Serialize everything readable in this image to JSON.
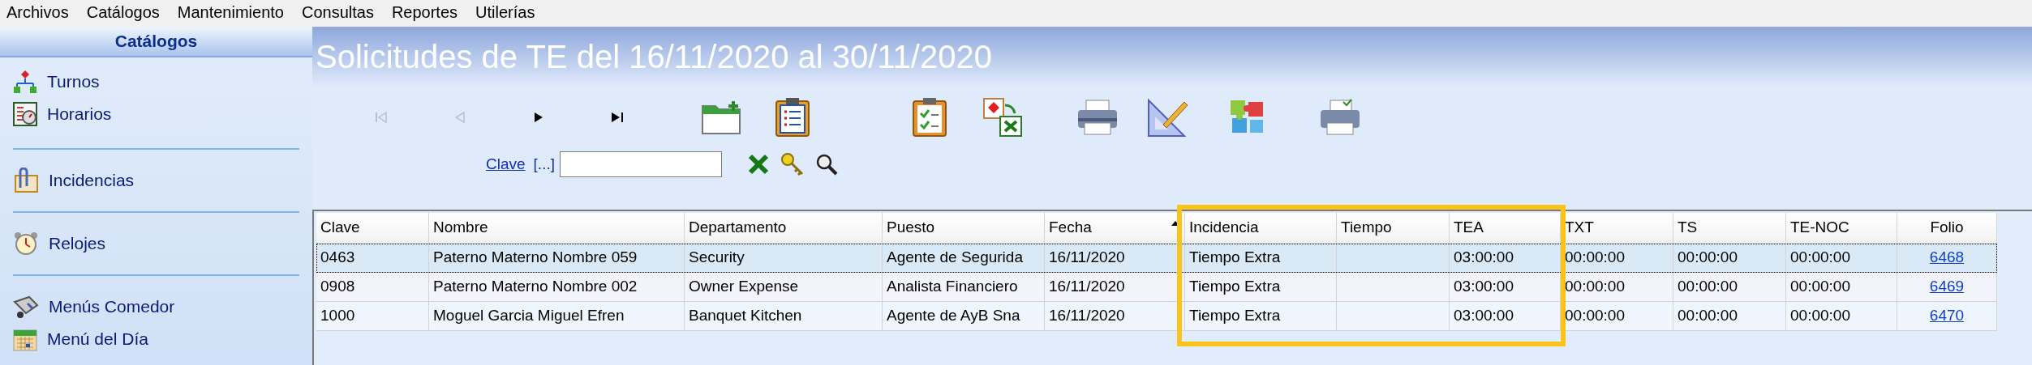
{
  "menu_bar": [
    "Archivos",
    "Catálogos",
    "Mantenimiento",
    "Consultas",
    "Reportes",
    "Utilerías"
  ],
  "sidebar": {
    "title": "Catálogos",
    "groups": [
      {
        "items": [
          {
            "label": "Turnos",
            "kind": "tree"
          },
          {
            "label": "Horarios",
            "kind": "schedule"
          }
        ]
      },
      {
        "items": [
          {
            "label": "Incidencias",
            "kind": "clip"
          }
        ]
      },
      {
        "items": [
          {
            "label": "Relojes",
            "kind": "alarm"
          }
        ]
      },
      {
        "items": [
          {
            "label": "Menús Comedor",
            "kind": "dining"
          },
          {
            "label": "Menú del Día",
            "kind": "calendar"
          }
        ]
      }
    ]
  },
  "title": "Solicitudes de TE del 16/11/2020 al 30/11/2020",
  "nav_buttons": [
    {
      "kind": "first",
      "disabled": true
    },
    {
      "kind": "prev",
      "disabled": true
    },
    {
      "kind": "next",
      "disabled": false
    },
    {
      "kind": "last",
      "disabled": false
    }
  ],
  "filter": {
    "label": "Clave",
    "browse": "[...]"
  },
  "table": {
    "columns": [
      {
        "label": "Clave",
        "sorted": false
      },
      {
        "label": "Nombre",
        "sorted": false
      },
      {
        "label": "Departamento",
        "sorted": false
      },
      {
        "label": "Puesto",
        "sorted": false
      },
      {
        "label": "Fecha",
        "sorted": true
      },
      {
        "label": "Incidencia",
        "sorted": false
      },
      {
        "label": "Tiempo",
        "sorted": false
      },
      {
        "label": "TEA",
        "sorted": false
      },
      {
        "label": "TXT",
        "sorted": false
      },
      {
        "label": "TS",
        "sorted": false
      },
      {
        "label": "TE-NOC",
        "sorted": false
      },
      {
        "label": "Folio",
        "sorted": false
      }
    ],
    "highlight_frame": true,
    "rows": [
      {
        "selected": true,
        "cells": [
          "0463",
          "Paterno  Materno  Nombre 059",
          "Security",
          "Agente de Segurida",
          "16/11/2020",
          "Tiempo Extra",
          "",
          "03:00:00",
          "00:00:00",
          "00:00:00",
          "00:00:00",
          "6468"
        ]
      },
      {
        "selected": false,
        "cells": [
          "0908",
          "Paterno  Materno  Nombre 002",
          "Owner Expense",
          "Analista Financiero",
          "16/11/2020",
          "Tiempo Extra",
          "",
          "03:00:00",
          "00:00:00",
          "00:00:00",
          "00:00:00",
          "6469"
        ]
      },
      {
        "selected": false,
        "cells": [
          "1000",
          "Moguel Garcia Miguel Efren",
          "Banquet Kitchen",
          "Agente de AyB Sna",
          "16/11/2020",
          "Tiempo Extra",
          "",
          "03:00:00",
          "00:00:00",
          "00:00:00",
          "00:00:00",
          "6470"
        ]
      }
    ]
  }
}
